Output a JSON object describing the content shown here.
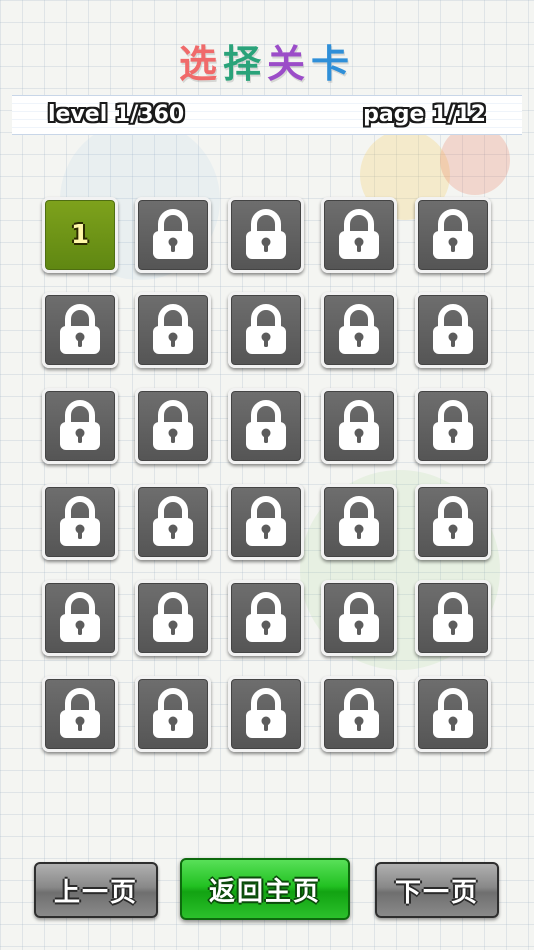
{
  "title": {
    "chars": [
      "选",
      "择",
      "关",
      "卡"
    ],
    "colors": [
      "#f06a6a",
      "#2aa37a",
      "#9b4dc8",
      "#2f8fd8"
    ]
  },
  "info": {
    "level": "level 1/360",
    "page": "page 1/12"
  },
  "levels": {
    "columns": 5,
    "rows": 6,
    "unlocked": [
      {
        "index": 0,
        "label": "1"
      }
    ]
  },
  "buttons": {
    "prev": "上一页",
    "home": "返回主页",
    "next": "下一页"
  },
  "colors": {
    "locked_tile": "#5f5f5f",
    "unlocked_tile": "#6e9618",
    "home_button": "#22c122",
    "nav_button": "#8a8a8a"
  }
}
